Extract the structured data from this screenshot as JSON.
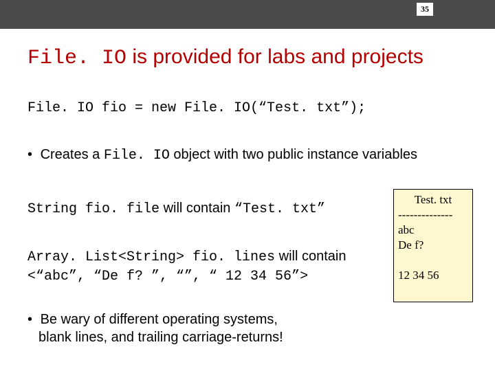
{
  "page_number": "35",
  "title": {
    "code": "File. IO",
    "rest": " is provided for labs and projects"
  },
  "code_line": "File. IO fio = new File. IO(“Test. txt”);",
  "bullet1": {
    "dot": "•",
    "pre": " Creates a ",
    "code": "File. IO",
    "post": " object with two public instance variables"
  },
  "line2": {
    "code": "String fio. file",
    "mid": " will contain ",
    "code2": "“Test. txt”"
  },
  "line3": {
    "code1": "Array. List<String> fio. lines",
    "mid": " will contain ",
    "code2": "<“abc”, “De f? ”, “”, “ 12 34 56”>"
  },
  "bullet2": {
    "dot": "•",
    "l1": " Be wary of different operating systems,",
    "l2": "blank lines, and trailing carriage-returns!"
  },
  "file_box": {
    "fname": "Test. txt",
    "dashes": "--------------",
    "l1": "abc",
    "l2": "De f?",
    "l3": " ",
    "l4": "12 34 56"
  }
}
